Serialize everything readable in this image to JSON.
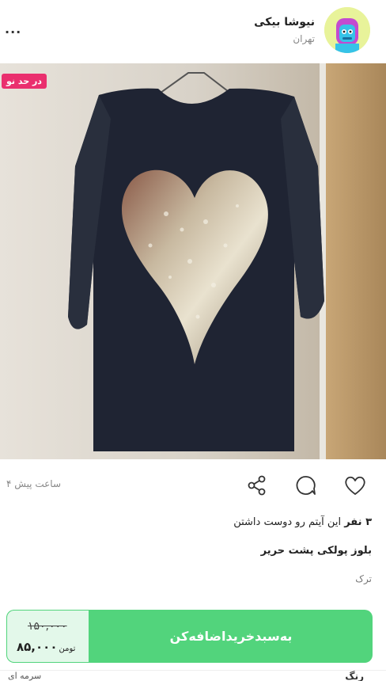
{
  "seller": {
    "name": "نیوشا بیکی",
    "city": "تهران"
  },
  "menu": {
    "more_label": "..."
  },
  "product": {
    "badge": "در حد نو",
    "posted": "۴ ساعت پیش",
    "likes_prefix": "۳ نفر",
    "likes_suffix": " این آیتم رو دوست داشتن",
    "title": "بلوز پولکی پشت حریر",
    "brand": "ترک"
  },
  "icons": {
    "heart": "heart-icon",
    "comment": "comment-icon",
    "share": "share-icon",
    "more": "more-dots-icon"
  },
  "cta": {
    "old_price": "۱۵۰,۰۰۰",
    "new_price": "۸۵,۰۰۰",
    "unit": "تومن",
    "label": "به‌سبد‌خرید‌اضافه‌کن"
  },
  "footer_peek": {
    "left": "سرمه ای",
    "right": "رنگ"
  },
  "colors": {
    "accent": "#52d47c",
    "badge": "#ea2f6e",
    "avatar_bg": "#e8f39a"
  }
}
